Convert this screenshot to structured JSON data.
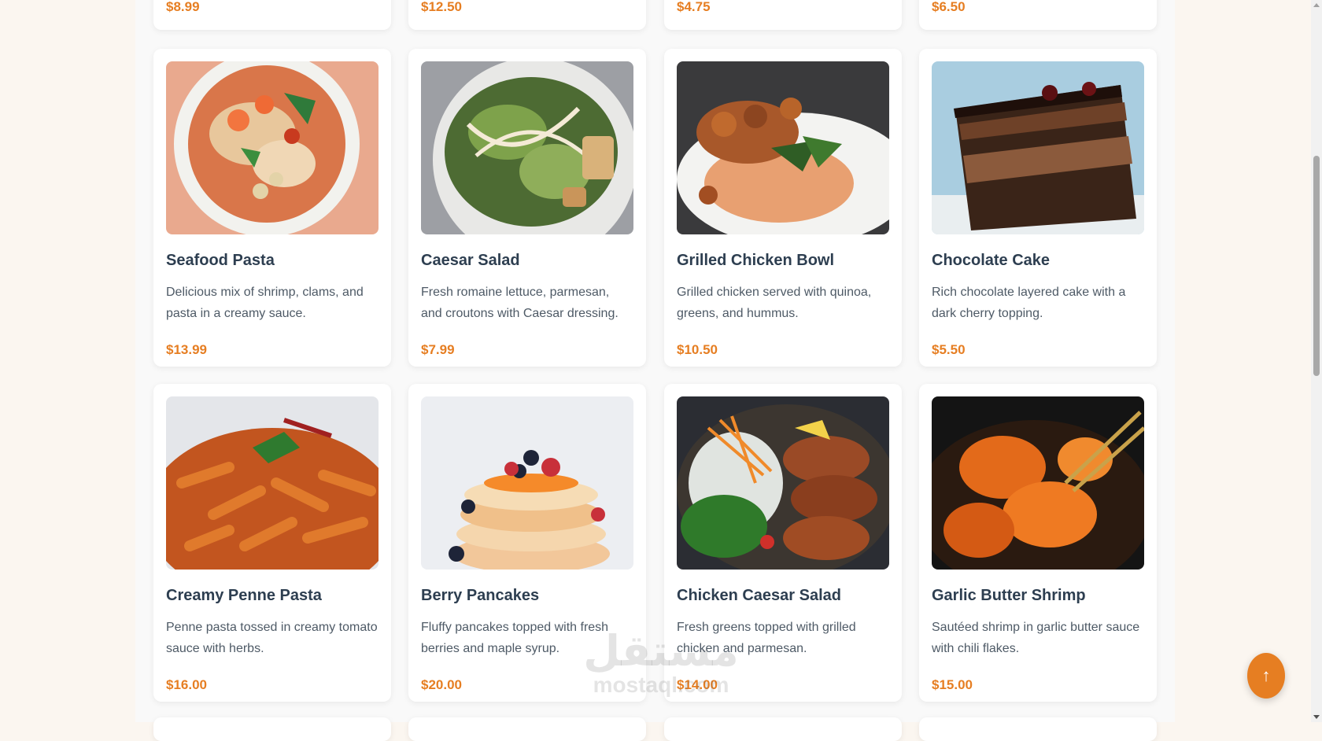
{
  "colors": {
    "accent": "#e67e22",
    "title": "#2d3e50",
    "text": "#4e5a66"
  },
  "top_row_prices": [
    "$8.99",
    "$12.50",
    "$4.75",
    "$6.50"
  ],
  "menu": {
    "rows": [
      [
        {
          "name": "Seafood Pasta",
          "description": "Delicious mix of shrimp, clams, and pasta in a creamy sauce.",
          "price": "$13.99"
        },
        {
          "name": "Caesar Salad",
          "description": "Fresh romaine lettuce, parmesan, and croutons with Caesar dressing.",
          "price": "$7.99"
        },
        {
          "name": "Grilled Chicken Bowl",
          "description": "Grilled chicken served with quinoa, greens, and hummus.",
          "price": "$10.50"
        },
        {
          "name": "Chocolate Cake",
          "description": "Rich chocolate layered cake with a dark cherry topping.",
          "price": "$5.50"
        }
      ],
      [
        {
          "name": "Creamy Penne Pasta",
          "description": "Penne pasta tossed in creamy tomato sauce with herbs.",
          "price": "$16.00"
        },
        {
          "name": "Berry Pancakes",
          "description": "Fluffy pancakes topped with fresh berries and maple syrup.",
          "price": "$20.00"
        },
        {
          "name": "Chicken Caesar Salad",
          "description": "Fresh greens topped with grilled chicken and parmesan.",
          "price": "$14.00"
        },
        {
          "name": "Garlic Butter Shrimp",
          "description": "Sautéed shrimp in garlic butter sauce with chili flakes.",
          "price": "$15.00"
        }
      ]
    ]
  },
  "back_to_top": {
    "label": "↑"
  },
  "watermark": {
    "arabic": "مستقل",
    "latin": "mostaql.com"
  }
}
